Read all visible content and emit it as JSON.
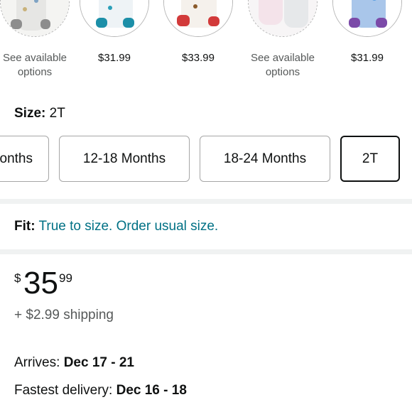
{
  "variations": [
    {
      "name": "swatch-1",
      "price_text": "See available options",
      "style": "dashed"
    },
    {
      "name": "swatch-2",
      "price_text": "$31.99",
      "style": "solid"
    },
    {
      "name": "swatch-3",
      "price_text": "$33.99",
      "style": "solid"
    },
    {
      "name": "swatch-4",
      "price_text": "See available options",
      "style": "dashed"
    },
    {
      "name": "swatch-5",
      "price_text": "$31.99",
      "style": "solid"
    }
  ],
  "size": {
    "label": "Size:",
    "selected": "2T",
    "options": [
      "Months",
      "12-18 Months",
      "18-24 Months",
      "2T"
    ]
  },
  "fit": {
    "label": "Fit:",
    "value": "True to size. Order usual size."
  },
  "price": {
    "currency": "$",
    "whole": "35",
    "fraction": "99",
    "shipping": "+ $2.99 shipping"
  },
  "delivery": {
    "arrives_label": "Arrives:",
    "arrives_date": "Dec 17 - 21",
    "fastest_label": "Fastest delivery:",
    "fastest_date": "Dec 16 - 18"
  },
  "colors": {
    "link": "#007185",
    "divider": "#f0f2f2",
    "muted": "#565959"
  }
}
